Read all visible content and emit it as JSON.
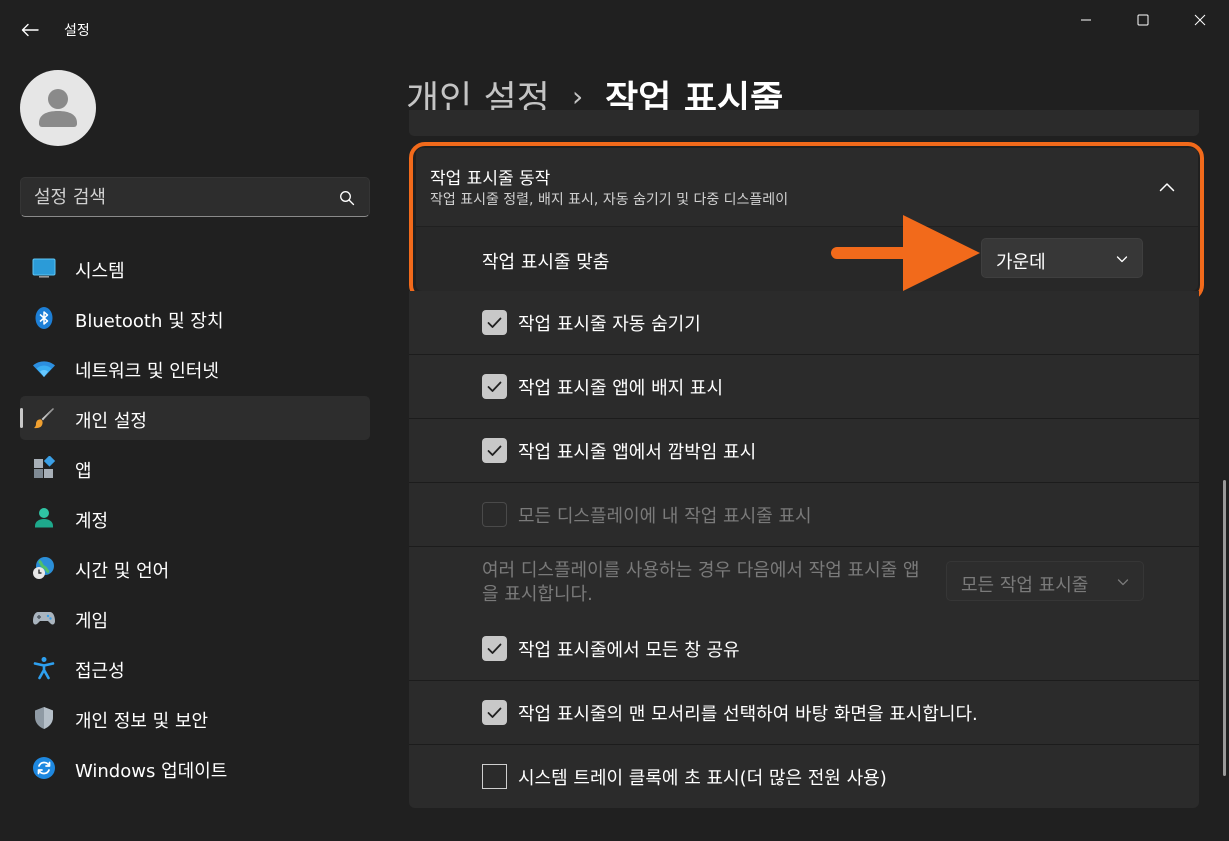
{
  "window": {
    "app_title": "설정",
    "back_icon": "back-arrow-icon",
    "controls": [
      "minimize-icon",
      "maximize-icon",
      "close-icon"
    ]
  },
  "search": {
    "placeholder": "설정 검색",
    "icon": "search-icon"
  },
  "sidebar": {
    "items": [
      {
        "label": "시스템",
        "icon": "monitor-icon",
        "selected": false
      },
      {
        "label": "Bluetooth 및 장치",
        "icon": "bluetooth-icon",
        "selected": false
      },
      {
        "label": "네트워크 및 인터넷",
        "icon": "wifi-icon",
        "selected": false
      },
      {
        "label": "개인 설정",
        "icon": "paintbrush-icon",
        "selected": true
      },
      {
        "label": "앱",
        "icon": "apps-icon",
        "selected": false
      },
      {
        "label": "계정",
        "icon": "account-icon",
        "selected": false
      },
      {
        "label": "시간 및 언어",
        "icon": "globe-clock-icon",
        "selected": false
      },
      {
        "label": "게임",
        "icon": "gamepad-icon",
        "selected": false
      },
      {
        "label": "접근성",
        "icon": "accessibility-icon",
        "selected": false
      },
      {
        "label": "개인 정보 및 보안",
        "icon": "shield-icon",
        "selected": false
      },
      {
        "label": "Windows 업데이트",
        "icon": "update-icon",
        "selected": false
      }
    ]
  },
  "header": {
    "breadcrumb_parent": "개인 설정",
    "separator": "›",
    "breadcrumb_current": "작업 표시줄"
  },
  "behaviors": {
    "title": "작업 표시줄 동작",
    "description": "작업 표시줄 정렬, 배지 표시, 자동 숨기기 및 다중 디스플레이",
    "expanded": true,
    "alignment_label": "작업 표시줄 맞춤",
    "alignment_value": "가운데",
    "options": [
      {
        "label": "작업 표시줄 자동 숨기기",
        "checked": true,
        "disabled": false
      },
      {
        "label": "작업 표시줄 앱에 배지 표시",
        "checked": true,
        "disabled": false
      },
      {
        "label": "작업 표시줄 앱에서 깜박임 표시",
        "checked": true,
        "disabled": false
      },
      {
        "label": "모든 디스플레이에 내 작업 표시줄 표시",
        "checked": false,
        "disabled": true
      }
    ],
    "multi_display_label": "여러 디스플레이를 사용하는 경우 다음에서 작업 표시줄 앱을 표시합니다.",
    "multi_display_value": "모든 작업 표시줄",
    "options2": [
      {
        "label": "작업 표시줄에서 모든 창 공유",
        "checked": true,
        "disabled": false
      },
      {
        "label": "작업 표시줄의 맨 모서리를 선택하여 바탕 화면을 표시합니다.",
        "checked": true,
        "disabled": false
      },
      {
        "label": "시스템 트레이 클록에 초 표시(더 많은 전원 사용)",
        "checked": false,
        "disabled": false
      }
    ]
  },
  "annotation": {
    "highlight_color": "#f26a1b"
  }
}
